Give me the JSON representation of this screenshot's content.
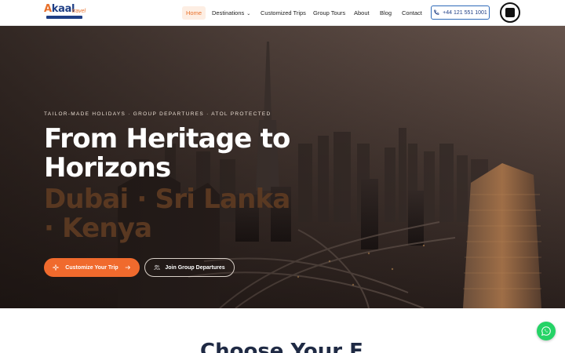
{
  "brand": {
    "logo_main_a": "A",
    "logo_main_rest": "kaal",
    "logo_sub": "travel"
  },
  "nav": {
    "items": [
      {
        "label": "Home",
        "active": true
      },
      {
        "label": "Destinations",
        "has_dropdown": true
      },
      {
        "label": "Customized Trips"
      },
      {
        "label": "Group Tours"
      },
      {
        "label": "About"
      },
      {
        "label": "Blog"
      },
      {
        "label": "Contact"
      }
    ],
    "phone": "+44 121 551 1001",
    "badge_icon": "atol-badge-icon"
  },
  "hero": {
    "eyebrow": "TAILOR-MADE HOLIDAYS · GROUP DEPARTURES · ATOL PROTECTED",
    "headline": "From Heritage to Horizons",
    "destinations": "Dubai · Sri Lanka · Kenya",
    "primary_cta": "Customize Your Trip",
    "secondary_cta": "Join Group Departures"
  },
  "section": {
    "title": "Choose Your E"
  },
  "colors": {
    "accent": "#f06a2d",
    "brand_blue": "#1f3f86",
    "whatsapp": "#25d366"
  }
}
